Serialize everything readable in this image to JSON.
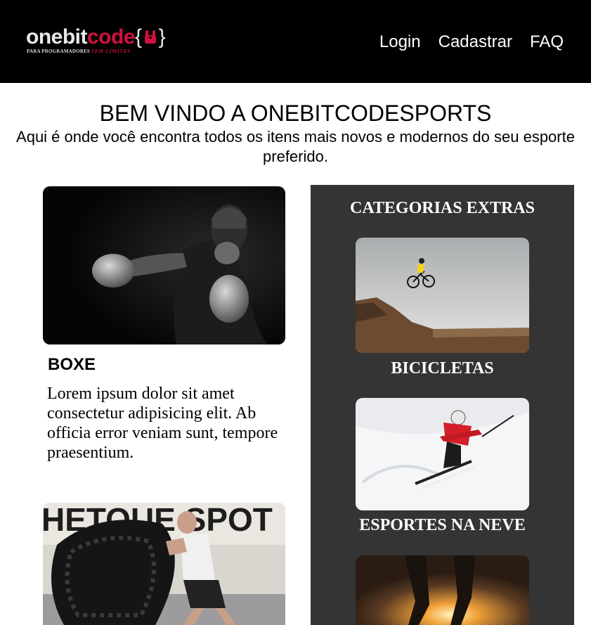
{
  "header": {
    "logo": {
      "one": "onebit",
      "code": "code",
      "brace_open": "{",
      "brace_close": "}",
      "tag_white": "PARA PROGRAMADORES",
      "tag_red": "SEM LIMITES"
    },
    "nav": [
      "Login",
      "Cadastrar",
      "FAQ"
    ]
  },
  "intro": {
    "title": "BEM VINDO A ONEBITCODESPORTS",
    "subtitle": "Aqui é onde você encontra todos os itens mais novos e modernos do seu esporte preferido."
  },
  "main": {
    "featured": {
      "title": "BOXE",
      "text": "Lorem ipsum dolor sit amet consectetur adipisicing elit. Ab officia error veniam sunt, tempore praesentium."
    },
    "second_image_text": "HETOUE SPOT"
  },
  "sidebar": {
    "title": "CATEGORIAS EXTRAS",
    "items": [
      "BICICLETAS",
      "ESPORTES NA NEVE"
    ]
  },
  "colors": {
    "brand_red": "#d1103c",
    "header_bg": "#000000",
    "sidebar_bg": "#353434"
  }
}
